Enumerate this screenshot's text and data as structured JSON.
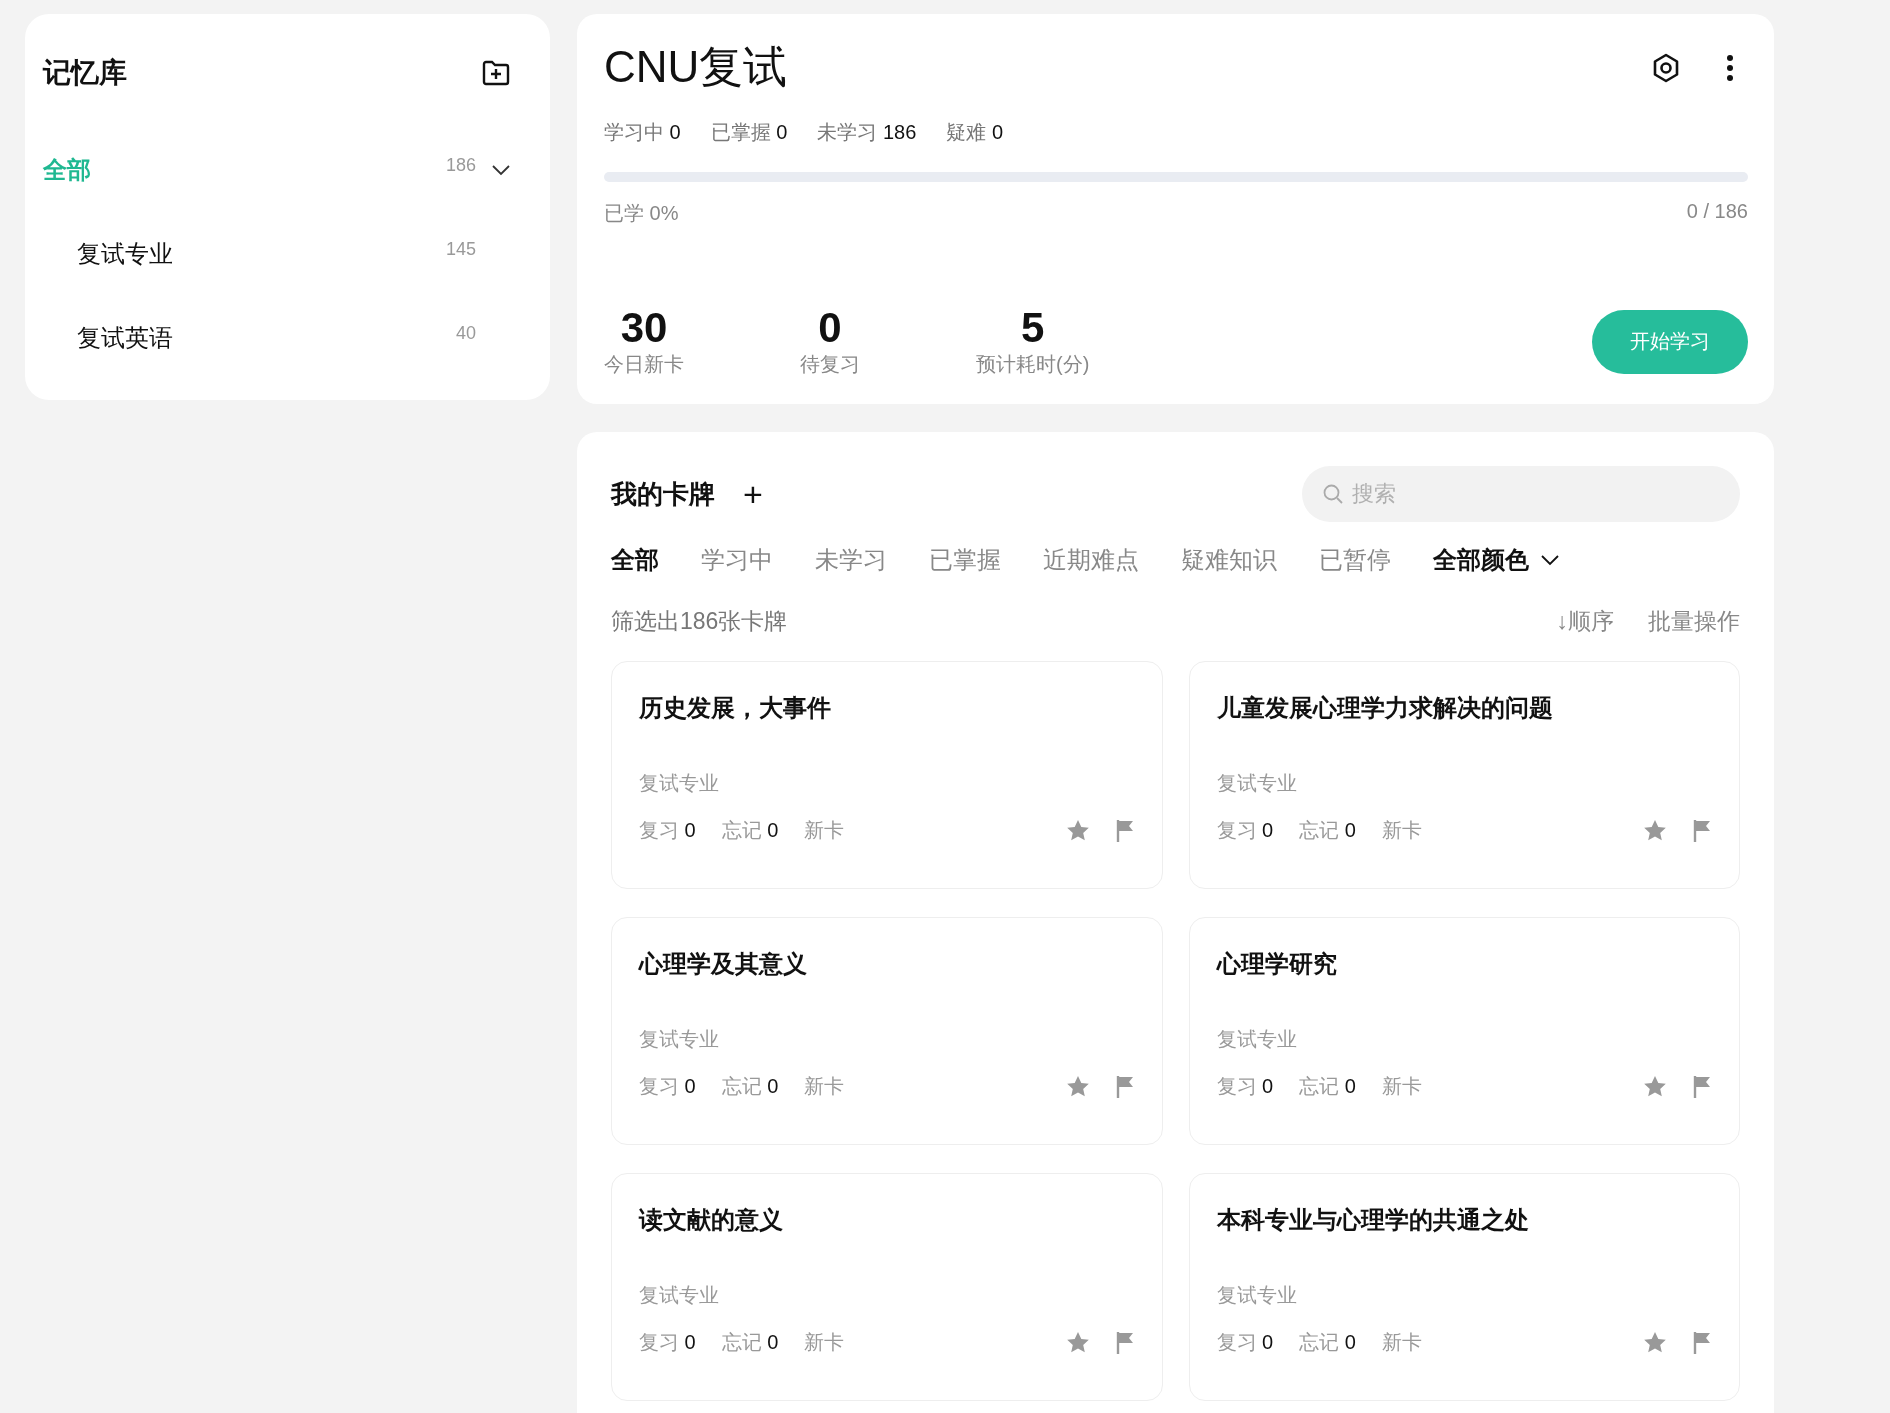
{
  "sidebar": {
    "title": "记忆库",
    "items": [
      {
        "label": "全部",
        "count": "186",
        "selected": true,
        "expanded": true,
        "children": [
          {
            "label": "复试专业",
            "count": "145",
            "selected": false
          },
          {
            "label": "复试英语",
            "count": "40",
            "selected": false
          }
        ]
      }
    ]
  },
  "deck": {
    "title": "CNU复试",
    "stats": [
      {
        "label": "学习中",
        "value": "0"
      },
      {
        "label": "已掌握",
        "value": "0"
      },
      {
        "label": "未学习",
        "value": "186"
      },
      {
        "label": "疑难",
        "value": "0"
      }
    ],
    "progress": {
      "level": 0,
      "label": "已学 0%",
      "count": "0 / 186"
    },
    "today": [
      {
        "value": "30",
        "label": "今日新卡"
      },
      {
        "value": "0",
        "label": "待复习"
      },
      {
        "value": "5",
        "label": "预计耗时(分)"
      }
    ],
    "start_button": "开始学习"
  },
  "cards_section": {
    "title": "我的卡牌",
    "add": "+",
    "search": {
      "placeholder": "搜索"
    },
    "tabs": [
      {
        "label": "全部",
        "selected": true
      },
      {
        "label": "学习中",
        "selected": false
      },
      {
        "label": "未学习",
        "selected": false
      },
      {
        "label": "已掌握",
        "selected": false
      },
      {
        "label": "近期难点",
        "selected": false
      },
      {
        "label": "疑难知识",
        "selected": false
      },
      {
        "label": "已暂停",
        "selected": false
      }
    ],
    "color_filter": "全部颜色",
    "result": "筛选出186张卡牌",
    "sort": "↓顺序",
    "batch": "批量操作",
    "cards": [
      {
        "title": "历史发展，大事件",
        "deck": "复试专业",
        "review_label": "复习",
        "review": "0",
        "forget_label": "忘记",
        "forget": "0",
        "status": "新卡"
      },
      {
        "title": "儿童发展心理学力求解决的问题",
        "deck": "复试专业",
        "review_label": "复习",
        "review": "0",
        "forget_label": "忘记",
        "forget": "0",
        "status": "新卡"
      },
      {
        "title": "心理学及其意义",
        "deck": "复试专业",
        "review_label": "复习",
        "review": "0",
        "forget_label": "忘记",
        "forget": "0",
        "status": "新卡"
      },
      {
        "title": "心理学研究",
        "deck": "复试专业",
        "review_label": "复习",
        "review": "0",
        "forget_label": "忘记",
        "forget": "0",
        "status": "新卡"
      },
      {
        "title": "读文献的意义",
        "deck": "复试专业",
        "review_label": "复习",
        "review": "0",
        "forget_label": "忘记",
        "forget": "0",
        "status": "新卡"
      },
      {
        "title": "本科专业与心理学的共通之处",
        "deck": "复试专业",
        "review_label": "复习",
        "review": "0",
        "forget_label": "忘记",
        "forget": "0",
        "status": "新卡"
      }
    ]
  }
}
